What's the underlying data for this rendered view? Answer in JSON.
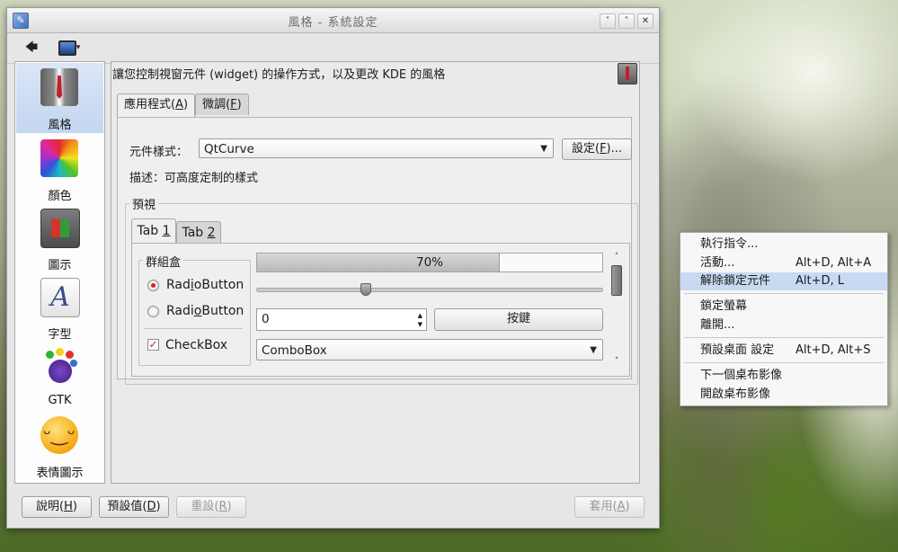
{
  "window": {
    "title": "風格 - 系統設定",
    "controls": [
      "˅",
      "˄",
      "✕"
    ]
  },
  "toolbar": {
    "back_glyph": "🡄",
    "overview_glyph": "▣"
  },
  "sidebar": {
    "items": [
      {
        "label": "風格",
        "icon": "suit-tie-icon"
      },
      {
        "label": "顏色",
        "icon": "color-wheel-icon"
      },
      {
        "label": "圖示",
        "icon": "cube-icon"
      },
      {
        "label": "字型",
        "icon": "font-a-icon"
      },
      {
        "label": "GTK",
        "icon": "gtk-foot-icon"
      },
      {
        "label": "表情圖示",
        "icon": "smiley-icon"
      }
    ]
  },
  "main": {
    "description": "讓您控制視窗元件 (widget) 的操作方式，以及更改 KDE 的風格",
    "tabs": [
      {
        "label": "應用程式(",
        "key": "A",
        "suffix": ")"
      },
      {
        "label": "微調(",
        "key": "F",
        "suffix": ")"
      }
    ],
    "style_label": "元件樣式：",
    "style_value": "QtCurve",
    "settings_button": {
      "pre": "設定(",
      "key": "F",
      "post": ")..."
    },
    "style_description": "描述：可高度定制的樣式",
    "preview": {
      "title": "預視",
      "tabs": [
        {
          "pre": "Tab ",
          "key": "1"
        },
        {
          "pre": "Tab ",
          "key": "2"
        }
      ],
      "groupbox_title": "群組盒",
      "radios": [
        {
          "pre": "Rad",
          "key": "i",
          "post": "oButton",
          "checked": true
        },
        {
          "pre": "Radi",
          "key": "o",
          "post": "Button",
          "checked": false
        }
      ],
      "checkbox": {
        "label": "CheckBox",
        "checked": true
      },
      "progress": {
        "value": 0.7,
        "text": "70%"
      },
      "slider": {
        "value": 0.31
      },
      "spinbox_value": "0",
      "push_button": "按鍵",
      "combobox": "ComboBox"
    }
  },
  "bottom": {
    "help": {
      "pre": "說明(",
      "key": "H",
      "post": ")"
    },
    "defaults": {
      "pre": "預設值(",
      "key": "D",
      "post": ")"
    },
    "reset": {
      "pre": "重設(",
      "key": "R",
      "post": ")"
    },
    "apply": {
      "pre": "套用(",
      "key": "A",
      "post": ")"
    }
  },
  "context_menu": {
    "items": [
      {
        "label": "執行指令...",
        "shortcut": ""
      },
      {
        "label": "活動...",
        "shortcut": "Alt+D, Alt+A"
      },
      {
        "label": "解除鎖定元件",
        "shortcut": "Alt+D, L",
        "highlighted": true
      },
      {
        "label": "鎖定螢幕",
        "shortcut": ""
      },
      {
        "label": "離開...",
        "shortcut": ""
      },
      {
        "label": "預設桌面 設定",
        "shortcut": "Alt+D, Alt+S"
      },
      {
        "label": "下一個桌布影像",
        "shortcut": ""
      },
      {
        "label": "開啟桌布影像",
        "shortcut": ""
      }
    ]
  },
  "colors": {
    "accent": "#d8202f",
    "selection": "#c8d9f2"
  }
}
